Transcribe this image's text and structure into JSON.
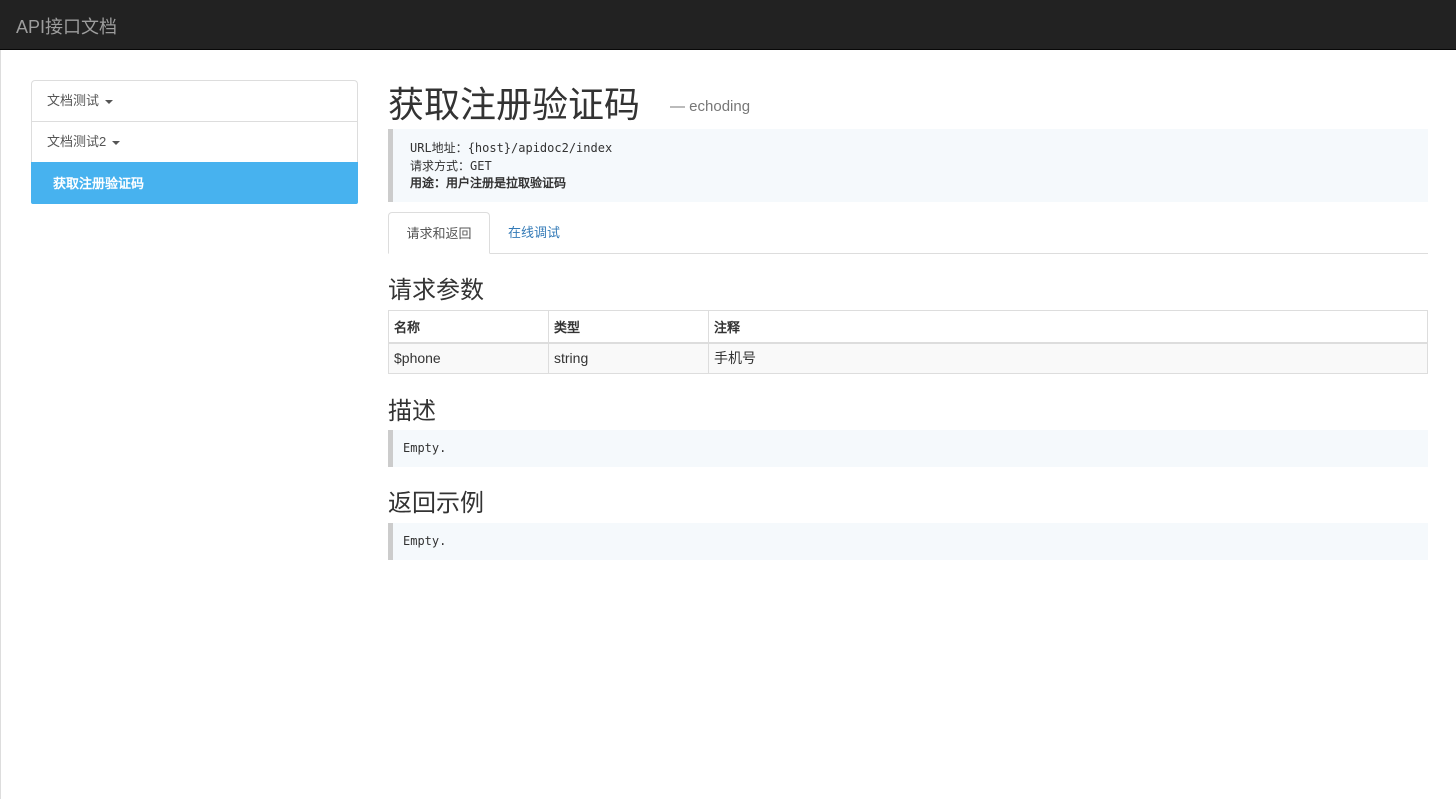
{
  "navbar": {
    "brand": "API接口文档"
  },
  "sidebar": {
    "items": [
      {
        "label": "文档测试",
        "has_caret": true
      },
      {
        "label": "文档测试2",
        "has_caret": true
      },
      {
        "label": "获取注册验证码",
        "active": true
      }
    ]
  },
  "main": {
    "title": "获取注册验证码",
    "author": "— echoding",
    "meta": {
      "url_label": "URL地址：",
      "url_value": "{host}/apidoc2/index",
      "method_label": "请求方式：",
      "method_value": "GET",
      "usage": "用途：用户注册是拉取验证码"
    },
    "tabs": [
      {
        "label": "请求和返回",
        "active": true
      },
      {
        "label": "在线调试",
        "active": false
      }
    ],
    "params_section": {
      "title": "请求参数",
      "columns": [
        "名称",
        "类型",
        "注释"
      ],
      "rows": [
        [
          "$phone",
          "string",
          "手机号"
        ]
      ]
    },
    "description_section": {
      "title": "描述",
      "content": "Empty."
    },
    "response_section": {
      "title": "返回示例",
      "content": "Empty."
    }
  },
  "colors": {
    "navbar_bg": "#222222",
    "active_item_bg": "#47b2ef",
    "link": "#337ab7"
  }
}
